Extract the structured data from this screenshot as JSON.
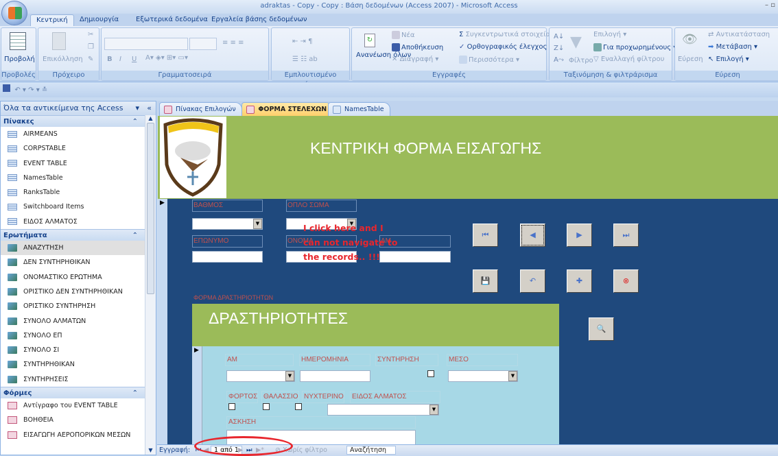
{
  "window": {
    "title": "adraktas - Copy - Copy : Βάση δεδομένων (Access 2007) - Microsoft Access"
  },
  "ribbon": {
    "tabs": [
      "Κεντρική",
      "Δημιουργία",
      "Εξωτερικά δεδομένα",
      "Εργαλεία βάσης δεδομένων"
    ],
    "groups": {
      "views": {
        "label": "Προβολές",
        "view": "Προβολή"
      },
      "clipboard": {
        "label": "Πρόχειρο",
        "paste": "Επικόλληση"
      },
      "font": {
        "label": "Γραμματοσειρά",
        "bold": "B",
        "italic": "I",
        "underline": "U"
      },
      "rich_text": {
        "label": "Εμπλουτισμένο κείμενο"
      },
      "records": {
        "label": "Εγγραφές",
        "refresh": "Ανανέωση όλων",
        "new": "Νέα",
        "save": "Αποθήκευση",
        "delete": "Διαγραφή",
        "totals": "Συγκεντρωτικά στοιχεία",
        "spelling": "Ορθογραφικός έλεγχος",
        "more": "Περισσότερα"
      },
      "sort_filter": {
        "label": "Ταξινόμηση & φιλτράρισμα",
        "filter": "Φίλτρο",
        "selection": "Επιλογή",
        "advanced": "Για προχωρημένους",
        "toggle": "Εναλλαγή φίλτρου"
      },
      "find": {
        "label": "Εύρεση",
        "find": "Εύρεση",
        "replace": "Αντικατάσταση",
        "goto": "Μετάβαση",
        "select": "Επιλογή"
      }
    }
  },
  "nav": {
    "header": "Όλα τα αντικείμενα της Access",
    "sections": [
      {
        "title": "Πίνακες",
        "items": [
          "AIRMEANS",
          "CORPSTABLE",
          "EVENT TABLE",
          "NamesTable",
          "RanksTable",
          "Switchboard Items",
          "ΕΙΔΟΣ ΑΛΜΑΤΟΣ"
        ]
      },
      {
        "title": "Ερωτήματα",
        "items": [
          "ΑΝΑΖΥΤΗΣΗ",
          "ΔΕΝ ΣΥΝΤΗΡΗΘΙΚΑΝ",
          "ΟΝΟΜΑΣΤΙΚΟ ΕΡΩΤΗΜΑ",
          "ΟΡΙΣΤΙΚΟ ΔΕΝ ΣΥΝΤΗΡΗΘΙΚΑΝ",
          "ΟΡΙΣΤΙΚΟ ΣΥΝΤΗΡΗΣΗ",
          "ΣΥΝΟΛΟ ΑΛΜΑΤΩΝ",
          "ΣΥΝΟΛΟ ΕΠ",
          "ΣΥΝΟΛΟ ΣΙ",
          "ΣΥΝΤΗΡΗΘΙΚΑΝ",
          "ΣΥΝΤΗΡΗΣΕΙΣ"
        ]
      },
      {
        "title": "Φόρμες",
        "items": [
          "Αντίγραφο του EVENT TABLE",
          "ΒΟΗΘΕΙΑ",
          "ΕΙΣΑΓΩΓΗ ΑΕΡΟΠΟΡΙΚΩΝ ΜΕΣΩΝ"
        ]
      }
    ]
  },
  "doc_tabs": [
    "Πίνακας Επιλογών",
    "ΦΟΡΜΑ ΣΤΕΛΕΧΩΝ",
    "NamesTable"
  ],
  "form": {
    "title": "ΚΕΝΤΡΙΚΗ ΦΟΡΜΑ ΕΙΣΑΓΩΓΗΣ",
    "labels": {
      "rank": "ΒΑΘΜΟΣ",
      "corps": "ΟΠΛΟ ΣΩΜΑ",
      "surname": "ΕΠΩΝΥΜΟ",
      "name": "ΟΝΟΜΑ",
      "am": "ΑΜ"
    },
    "subform_label": "ΦΟΡΜΑ ΔΡΑΣΤΗΡΙΟΤΗΤΩΝ",
    "subform": {
      "title": "ΔΡΑΣΤΗΡΙΟΤΗΤΕΣ",
      "labels": {
        "am": "ΑΜ",
        "date": "ΗΜΕΡΟΜΗΝΙΑ",
        "maintenance": "ΣΥΝΤΗΡΗΣΗ",
        "means": "ΜΕΣΟ",
        "load": "ΦΟΡΤΟΣ",
        "sea": "ΘΑΛΑΣΣΙΟ",
        "night": "ΝΥΧΤΕΡΙΝΟ",
        "jump_type": "ΕΙΔΟΣ ΑΛΜΑΤΟΣ",
        "exercise": "ΑΣΚΗΣΗ"
      }
    }
  },
  "annotation": {
    "lines": [
      "I click here and I",
      "can not navigate to",
      "the records.. !!!"
    ],
    "color": "#e8262d"
  },
  "status": {
    "record_label": "Εγγραφή:",
    "position": "1 από 1",
    "filter": "Χωρίς φίλτρο",
    "search": "Αναζήτηση"
  }
}
